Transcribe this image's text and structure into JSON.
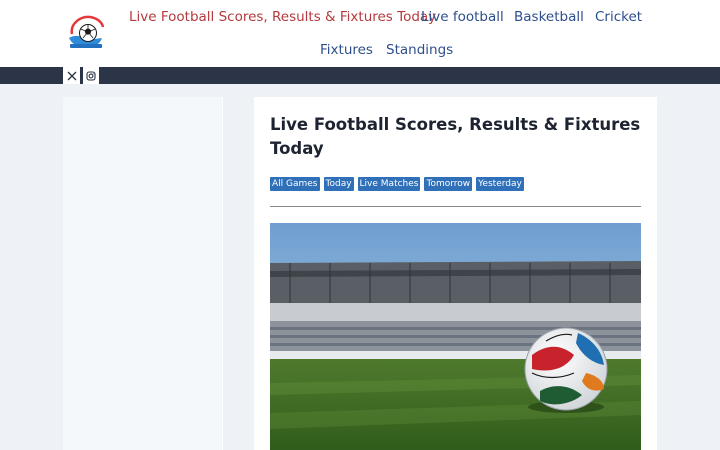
{
  "header": {
    "logo_icon": "football-logo-icon",
    "nav": [
      {
        "label": "Live Football Scores, Results & Fixtures Today",
        "active": true
      },
      {
        "label": "Live football"
      },
      {
        "label": "Basketball"
      },
      {
        "label": "Cricket"
      },
      {
        "label": "Fixtures"
      },
      {
        "label": "Standings"
      }
    ]
  },
  "social": {
    "icons": [
      "x-twitter-icon",
      "instagram-icon"
    ]
  },
  "article": {
    "title": "Live Football Scores, Results & Fixtures Today",
    "tags": [
      "All Games",
      "Today",
      "Live Matches",
      "Tomorrow",
      "Yesterday"
    ],
    "hero_image": "football-stadium-ball-image"
  },
  "colors": {
    "nav_link": "#2e4f8c",
    "nav_active": "#b5393d",
    "topbar": "#2c3447",
    "tag_bg": "#2f70b9",
    "page_bg": "#eef2f6"
  }
}
